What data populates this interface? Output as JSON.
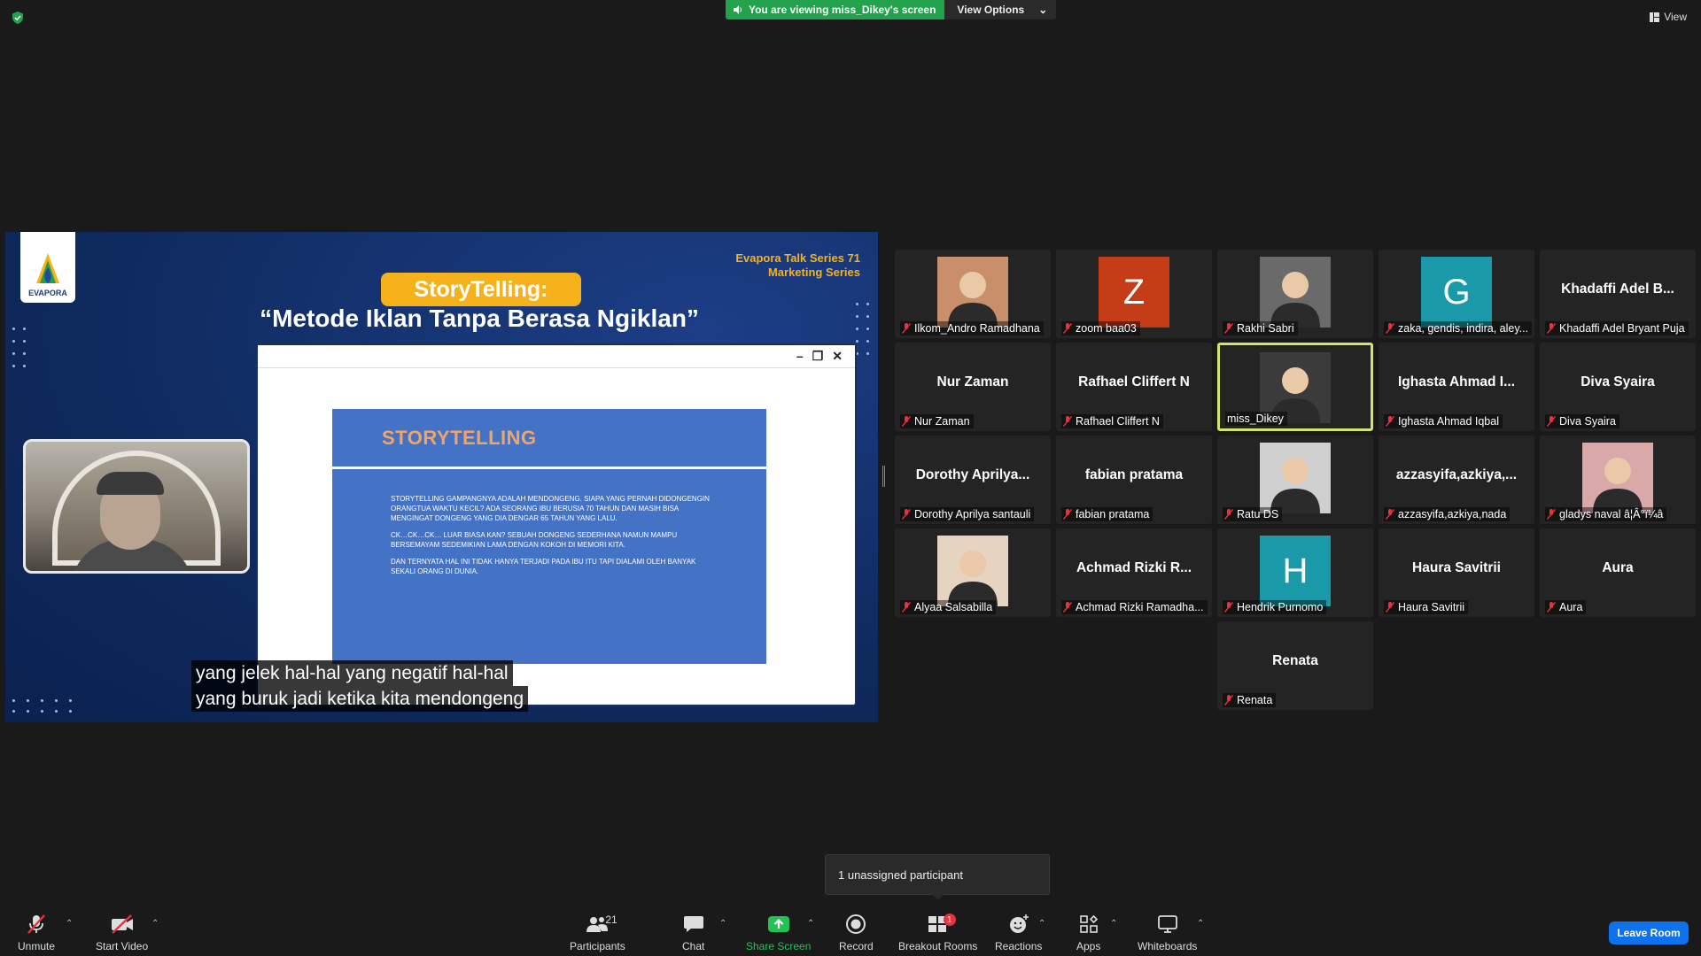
{
  "top": {
    "viewing_text": "You are viewing miss_Dikey's screen",
    "view_options_label": "View Options",
    "view_label": "View"
  },
  "share": {
    "logo_text": "EVAPORA",
    "series_line1": "Evapora Talk Series 71",
    "series_line2": "Marketing Series",
    "pill_title": "StoryTelling:",
    "main_title": "“Metode Iklan Tanpa Berasa Ngiklan”",
    "slide_title": "STORYTELLING",
    "slide_p1": "STORYTELLING GAMPANGNYA ADALAH MENDONGENG.  SIAPA YANG PERNAH DIDONGENGIN ORANGTUA WAKTU KECIL? ADA SEORANG IBU BERUSIA 70 TAHUN DAN MASIH BISA MENGINGAT DONGENG YANG DIA DENGAR 65 TAHUN YANG LALU.",
    "slide_p2": "CK…CK…CK…  LUAR BIASA KAN? SEBUAH DONGENG SEDERHANA NAMUN MAMPU BERSEMAYAM SEDEMIKIAN LAMA DENGAN KOKOH DI MEMORI KITA.",
    "slide_p3": "DAN TERNYATA HAL INI TIDAK HANYA TERJADI PADA IBU ITU TAPI DIALAMI OLEH BANYAK SEKALI ORANG DI DUNIA.",
    "caption_line1": "yang jelek hal-hal yang negatif hal-hal",
    "caption_line2": "yang buruk jadi ketika kita mendongeng"
  },
  "gallery": {
    "tiles": [
      {
        "name": "Ilkom_Andro Ramadhana",
        "display": "",
        "kind": "photo",
        "color": "#c98f6b",
        "muted": true,
        "active": false
      },
      {
        "name": "zoom baa03",
        "display": "Z",
        "kind": "letter",
        "color": "#c43d16",
        "muted": true,
        "active": false
      },
      {
        "name": "Rakhi Sabri",
        "display": "",
        "kind": "photo",
        "color": "#6a6a6a",
        "muted": true,
        "active": false
      },
      {
        "name": "zaka, gendis, indira, aley...",
        "display": "G",
        "kind": "letter",
        "color": "#1a9aa8",
        "muted": true,
        "active": false
      },
      {
        "name": "Khadaffi Adel Bryant Puja",
        "display": "Khadaffi Adel B...",
        "kind": "text",
        "color": "",
        "muted": true,
        "active": false
      },
      {
        "name": "Nur Zaman",
        "display": "Nur Zaman",
        "kind": "text",
        "color": "",
        "muted": true,
        "active": false
      },
      {
        "name": "Rafhael Cliffert N",
        "display": "Rafhael Cliffert N",
        "kind": "text",
        "color": "",
        "muted": true,
        "active": false
      },
      {
        "name": "miss_Dikey",
        "display": "",
        "kind": "photo",
        "color": "#3b3b3b",
        "muted": false,
        "active": true
      },
      {
        "name": "Ighasta Ahmad Iqbal",
        "display": "Ighasta Ahmad I...",
        "kind": "text",
        "color": "",
        "muted": true,
        "active": false
      },
      {
        "name": "Diva Syaira",
        "display": "Diva Syaira",
        "kind": "text",
        "color": "",
        "muted": true,
        "active": false
      },
      {
        "name": "Dorothy Aprilya santauli",
        "display": "Dorothy  Aprilya...",
        "kind": "text",
        "color": "",
        "muted": true,
        "active": false
      },
      {
        "name": "fabian pratama",
        "display": "fabian pratama",
        "kind": "text",
        "color": "",
        "muted": true,
        "active": false
      },
      {
        "name": "Ratu DS",
        "display": "",
        "kind": "photo",
        "color": "#cfcfcf",
        "muted": true,
        "active": false
      },
      {
        "name": "azzasyifa,azkiya,nada",
        "display": "azzasyifa,azkiya,...",
        "kind": "text",
        "color": "",
        "muted": true,
        "active": false
      },
      {
        "name": "gladys naval â¦Â°ï¼â",
        "display": "",
        "kind": "photo",
        "color": "#d9a8a8",
        "muted": true,
        "active": false
      },
      {
        "name": "Alyaa Salsabilla",
        "display": "",
        "kind": "photo",
        "color": "#e6d3c0",
        "muted": true,
        "active": false
      },
      {
        "name": "Achmad Rizki Ramadha...",
        "display": "Achmad  Rizki  R...",
        "kind": "text",
        "color": "",
        "muted": true,
        "active": false
      },
      {
        "name": "Hendrik Purnomo",
        "display": "H",
        "kind": "letter",
        "color": "#1a9aa8",
        "muted": true,
        "active": false
      },
      {
        "name": "Haura Savitrii",
        "display": "Haura Savitrii",
        "kind": "text",
        "color": "",
        "muted": true,
        "active": false
      },
      {
        "name": "Aura",
        "display": "Aura",
        "kind": "text",
        "color": "",
        "muted": true,
        "active": false
      },
      {
        "name": "Renata",
        "display": "Renata",
        "kind": "text",
        "color": "",
        "muted": true,
        "active": false
      }
    ]
  },
  "unassigned_text": "1 unassigned participant",
  "toolbar": {
    "unmute": "Unmute",
    "start_video": "Start Video",
    "participants": "Participants",
    "participants_count": "21",
    "chat": "Chat",
    "share_screen": "Share Screen",
    "record": "Record",
    "breakout_rooms": "Breakout Rooms",
    "breakout_badge": "1",
    "reactions": "Reactions",
    "apps": "Apps",
    "whiteboards": "Whiteboards",
    "leave_room": "Leave Room"
  },
  "colors": {
    "share_green": "#23a24d",
    "leave_blue": "#0e72ed",
    "active_border": "#d4e36b",
    "muted_red": "#e8323c"
  }
}
